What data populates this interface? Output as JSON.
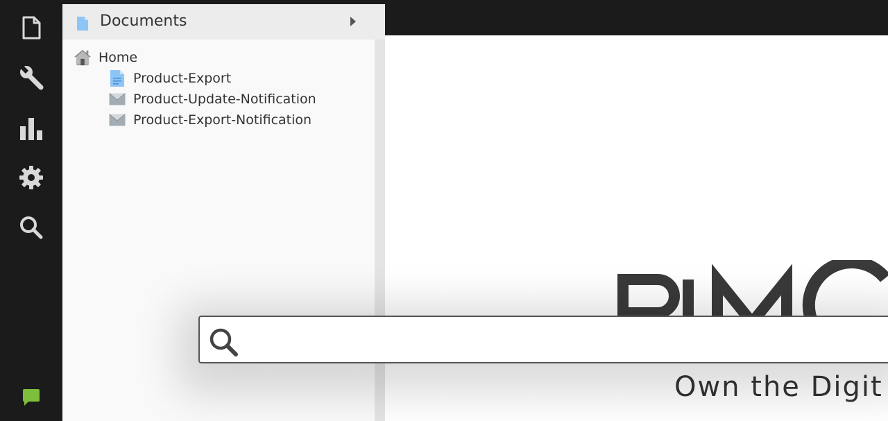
{
  "nav": {
    "items": [
      {
        "name": "documents",
        "icon": "file-icon"
      },
      {
        "name": "tools",
        "icon": "wrench-icon"
      },
      {
        "name": "marketing",
        "icon": "bar-chart-icon"
      },
      {
        "name": "settings",
        "icon": "gear-icon"
      },
      {
        "name": "search",
        "icon": "search-icon"
      }
    ],
    "bottom_icon": "chat-icon"
  },
  "tree_panel": {
    "title": "Documents",
    "root": {
      "label": "Home",
      "icon": "home-icon"
    },
    "children": [
      {
        "label": "Product-Export",
        "icon": "page-document-icon"
      },
      {
        "label": "Product-Update-Notification",
        "icon": "email-document-icon"
      },
      {
        "label": "Product-Export-Notification",
        "icon": "email-document-icon"
      }
    ]
  },
  "search": {
    "value": "",
    "placeholder": ""
  },
  "branding": {
    "logo_text": "PIMCORE",
    "tagline": "Own the Digit"
  },
  "colors": {
    "nav_bg": "#1b1b1b",
    "doc_icon_blue": "#8ec5f7",
    "chat_green": "#7bbf3a",
    "icon_grey": "#d8d8d8"
  }
}
